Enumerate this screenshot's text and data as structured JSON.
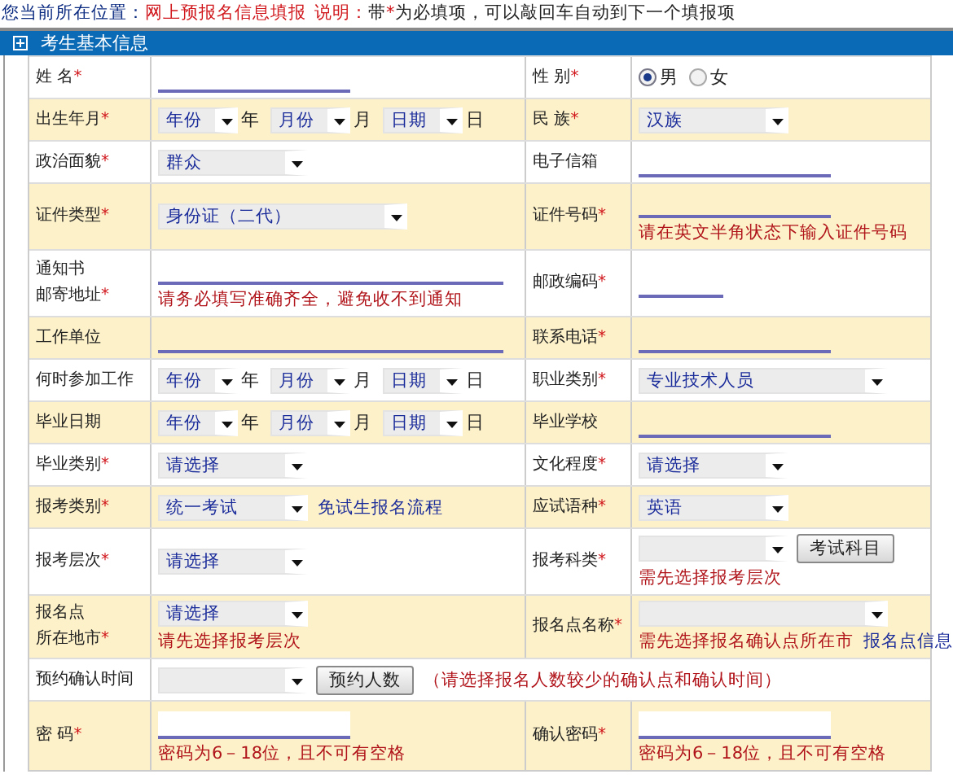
{
  "breadcrumb": {
    "label": "您当前所在位置：",
    "current": "网上预报名信息填报",
    "note_title": "说明：",
    "note_parts": [
      {
        "text": "带",
        "kind": "plain"
      },
      {
        "text": "*",
        "kind": "mark"
      },
      {
        "text": "为必填项，可以敲回车自动到下一个填报项",
        "kind": "plain"
      }
    ]
  },
  "section": {
    "title": "考生基本信息"
  },
  "rows": [
    {
      "tint": false,
      "left": {
        "label": [
          "姓 名"
        ],
        "mark": "*",
        "lines": [
          [
            {
              "kind": "input"
            }
          ]
        ]
      },
      "right": {
        "label": [
          "性 别"
        ],
        "mark": "*",
        "lines": [
          [
            {
              "kind": "radio",
              "text": "男",
              "selected": true
            },
            {
              "kind": "radio",
              "text": "女",
              "selected": false
            }
          ]
        ]
      }
    },
    {
      "tint": true,
      "left": {
        "label": [
          "出生年月"
        ],
        "mark": "*",
        "lines": [
          [
            {
              "kind": "dateselect",
              "value": "年份"
            },
            {
              "kind": "suffix",
              "text": "年"
            },
            {
              "kind": "dateselect",
              "value": "月份"
            },
            {
              "kind": "suffix",
              "text": "月"
            },
            {
              "kind": "dateselect",
              "value": "日期"
            },
            {
              "kind": "suffix",
              "text": "日"
            }
          ]
        ]
      },
      "right": {
        "label": [
          "民 族"
        ],
        "mark": "*",
        "lines": [
          [
            {
              "kind": "select",
              "value": "汉族"
            }
          ]
        ]
      }
    },
    {
      "tint": false,
      "left": {
        "label": [
          "政治面貌"
        ],
        "mark": "*",
        "lines": [
          [
            {
              "kind": "select",
              "value": "群众"
            }
          ]
        ]
      },
      "right": {
        "label": [
          "电子信箱"
        ],
        "lines": [
          [
            {
              "kind": "input"
            }
          ]
        ]
      }
    },
    {
      "tint": true,
      "left": {
        "label": [
          "证件类型"
        ],
        "mark": "*",
        "lines": [
          [
            {
              "kind": "wideselect",
              "value": "身份证（二代）"
            }
          ]
        ]
      },
      "right": {
        "label": [
          "证件号码"
        ],
        "mark": "*",
        "lines": [
          [
            {
              "kind": "input"
            }
          ],
          [
            {
              "kind": "note",
              "text": "请在英文半角状态下输入证件号码"
            }
          ]
        ]
      }
    },
    {
      "tint": false,
      "left": {
        "label": [
          "通知书",
          "邮寄地址"
        ],
        "mark": "*",
        "lines": [
          [
            {
              "kind": "longinput"
            }
          ],
          [
            {
              "kind": "note",
              "text": "请务必填写准确齐全，避免收不到通知"
            }
          ]
        ]
      },
      "right": {
        "label": [
          "邮政编码"
        ],
        "mark": "*",
        "lines": [
          [
            {
              "kind": "shortinput"
            }
          ]
        ]
      }
    },
    {
      "tint": true,
      "left": {
        "label": [
          "工作单位"
        ],
        "lines": [
          [
            {
              "kind": "longinput"
            }
          ]
        ]
      },
      "right": {
        "label": [
          "联系电话"
        ],
        "mark": "*",
        "lines": [
          [
            {
              "kind": "input"
            }
          ]
        ]
      }
    },
    {
      "tint": false,
      "left": {
        "label": [
          "何时参加工作"
        ],
        "lines": [
          [
            {
              "kind": "dateselect",
              "value": "年份"
            },
            {
              "kind": "suffix",
              "text": "年"
            },
            {
              "kind": "dateselect",
              "value": "月份"
            },
            {
              "kind": "suffix",
              "text": "月"
            },
            {
              "kind": "dateselect",
              "value": "日期"
            },
            {
              "kind": "suffix",
              "text": "日"
            }
          ]
        ]
      },
      "right": {
        "label": [
          "职业类别"
        ],
        "mark": "*",
        "lines": [
          [
            {
              "kind": "wideselect",
              "value": "专业技术人员"
            }
          ]
        ]
      }
    },
    {
      "tint": true,
      "left": {
        "label": [
          "毕业日期"
        ],
        "lines": [
          [
            {
              "kind": "dateselect",
              "value": "年份"
            },
            {
              "kind": "suffix",
              "text": "年"
            },
            {
              "kind": "dateselect",
              "value": "月份"
            },
            {
              "kind": "suffix",
              "text": "月"
            },
            {
              "kind": "dateselect",
              "value": "日期"
            },
            {
              "kind": "suffix",
              "text": "日"
            }
          ]
        ]
      },
      "right": {
        "label": [
          "毕业学校"
        ],
        "lines": [
          [
            {
              "kind": "input"
            }
          ]
        ]
      }
    },
    {
      "tint": false,
      "left": {
        "label": [
          "毕业类别"
        ],
        "mark": "*",
        "lines": [
          [
            {
              "kind": "select",
              "value": "请选择"
            }
          ]
        ]
      },
      "right": {
        "label": [
          "文化程度"
        ],
        "mark": "*",
        "lines": [
          [
            {
              "kind": "select",
              "value": "请选择"
            }
          ]
        ]
      }
    },
    {
      "tint": true,
      "left": {
        "label": [
          "报考类别"
        ],
        "mark": "*",
        "lines": [
          [
            {
              "kind": "select",
              "value": "统一考试"
            },
            {
              "kind": "link",
              "text": "免试生报名流程"
            }
          ]
        ]
      },
      "right": {
        "label": [
          "应试语种"
        ],
        "mark": "*",
        "lines": [
          [
            {
              "kind": "select",
              "value": "英语"
            }
          ]
        ]
      }
    },
    {
      "tint": false,
      "left": {
        "label": [
          "报考层次"
        ],
        "mark": "*",
        "lines": [
          [
            {
              "kind": "select",
              "value": "请选择"
            }
          ]
        ]
      },
      "right": {
        "label": [
          "报考科类"
        ],
        "mark": "*",
        "lines": [
          [
            {
              "kind": "select"
            },
            {
              "kind": "button",
              "text": "考试科目"
            }
          ],
          [
            {
              "kind": "note",
              "text": "需先选择报考层次"
            }
          ]
        ]
      }
    },
    {
      "tint": true,
      "left": {
        "label": [
          "报名点",
          "所在地市"
        ],
        "mark": "*",
        "lines": [
          [
            {
              "kind": "select",
              "value": "请选择"
            }
          ],
          [
            {
              "kind": "note",
              "text": "请先选择报考层次"
            }
          ]
        ]
      },
      "right": {
        "label": [
          "报名点名称"
        ],
        "mark": "*",
        "lines": [
          [
            {
              "kind": "wideselect"
            }
          ],
          [
            {
              "kind": "note",
              "text": "需先选择报名确认点所在市"
            },
            {
              "kind": "link",
              "text": "报名点信息"
            }
          ]
        ]
      }
    },
    {
      "tint": false,
      "left": {
        "label": [
          "预约确认时间"
        ],
        "lines": [
          [
            {
              "kind": "select"
            },
            {
              "kind": "button",
              "text": "预约人数"
            },
            {
              "kind": "note",
              "text": "（请选择报名人数较少的确认点和确认时间）"
            }
          ]
        ]
      }
    },
    {
      "tint": true,
      "left": {
        "label": [
          "密 码"
        ],
        "mark": "*",
        "lines": [
          [
            {
              "kind": "boxinput"
            }
          ],
          [
            {
              "kind": "note",
              "text": "密码为6－18位，且不可有空格"
            }
          ]
        ]
      },
      "right": {
        "label": [
          "确认密码"
        ],
        "mark": "*",
        "lines": [
          [
            {
              "kind": "boxinput"
            }
          ],
          [
            {
              "kind": "note",
              "text": "密码为6－18位，且不可有空格"
            }
          ]
        ]
      }
    }
  ]
}
